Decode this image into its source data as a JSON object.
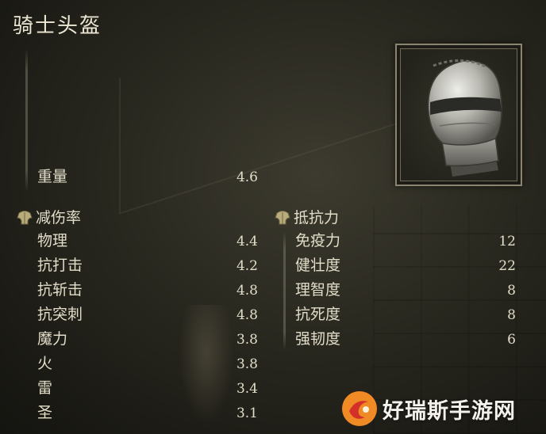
{
  "item": {
    "name": "骑士头盔",
    "weight_label": "重量",
    "weight_value": "4.6"
  },
  "damage_negation": {
    "header": "减伤率",
    "icon": "chest-armor-icon",
    "rows": [
      {
        "label": "物理",
        "value": "4.4"
      },
      {
        "label": "抗打击",
        "value": "4.2"
      },
      {
        "label": "抗斩击",
        "value": "4.8"
      },
      {
        "label": "抗突刺",
        "value": "4.8"
      },
      {
        "label": "魔力",
        "value": "3.8"
      },
      {
        "label": "火",
        "value": "3.8"
      },
      {
        "label": "雷",
        "value": "3.4"
      },
      {
        "label": "圣",
        "value": "3.1"
      }
    ]
  },
  "resistance": {
    "header": "抵抗力",
    "icon": "chest-armor-icon",
    "rows": [
      {
        "label": "免疫力",
        "value": "12"
      },
      {
        "label": "健壮度",
        "value": "22"
      },
      {
        "label": "理智度",
        "value": "8"
      },
      {
        "label": "抗死度",
        "value": "8"
      },
      {
        "label": "强韧度",
        "value": "6"
      }
    ]
  },
  "thumbnail": {
    "icon": "knight-helm-icon"
  },
  "watermark": {
    "text": "好瑞斯手游网",
    "logo": "watermark-logo-icon"
  },
  "colors": {
    "text": "#e2ddc8",
    "frame": "#8a8470",
    "logo_orange": "#f08a24",
    "logo_red": "#d4302a"
  }
}
